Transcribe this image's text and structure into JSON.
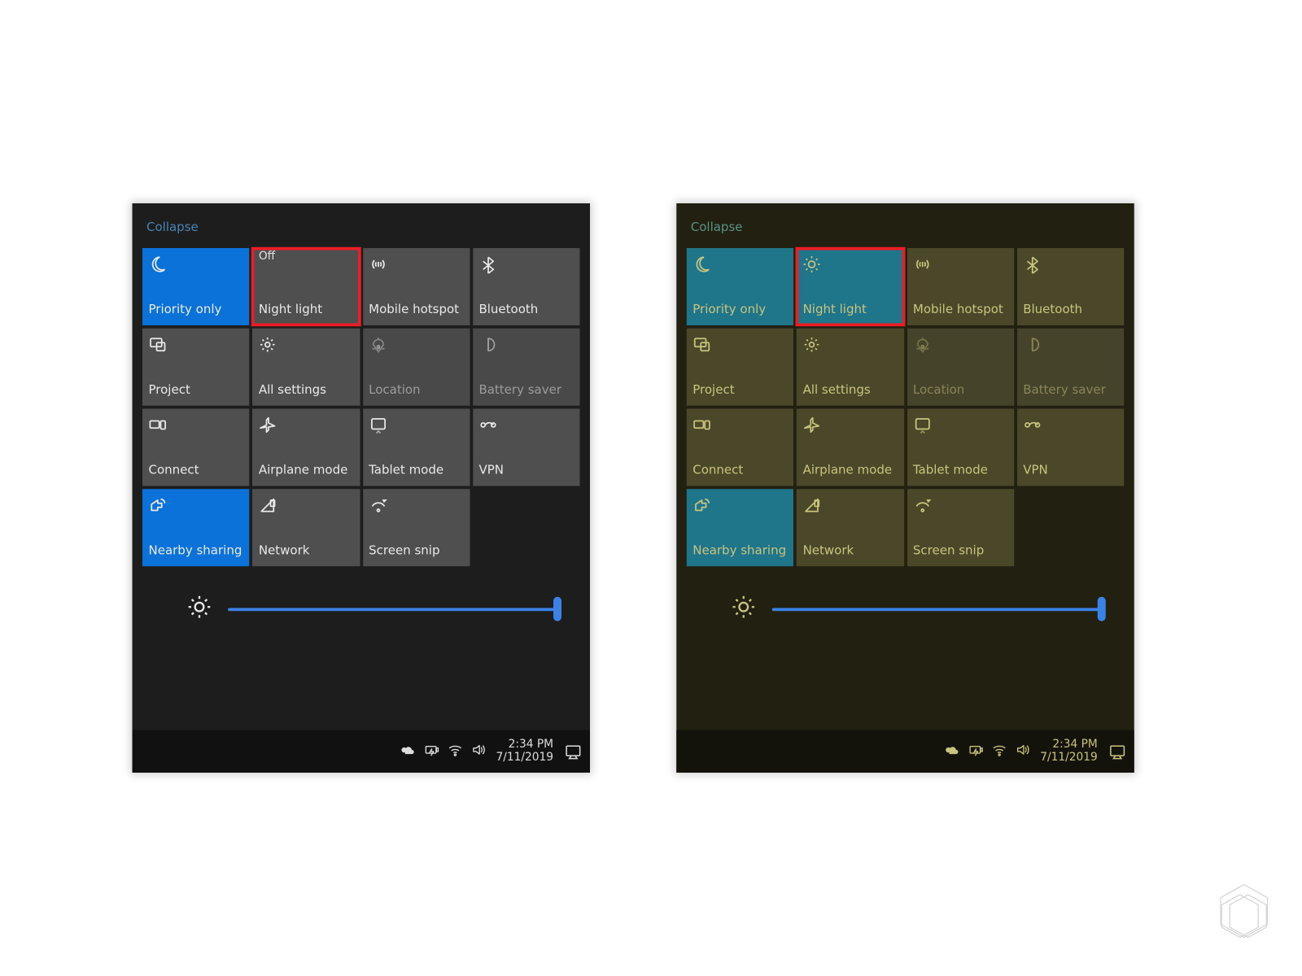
{
  "collapse_label": "Collapse",
  "night_light_status_off": "Off",
  "tiles": {
    "priority_only": "Priority only",
    "night_light": "Night light",
    "mobile_hotspot": "Mobile hotspot",
    "bluetooth": "Bluetooth",
    "project": "Project",
    "all_settings": "All settings",
    "location": "Location",
    "battery_saver": "Battery saver",
    "connect": "Connect",
    "airplane_mode": "Airplane mode",
    "tablet_mode": "Tablet mode",
    "vpn": "VPN",
    "nearby_sharing": "Nearby sharing",
    "network": "Network",
    "screen_snip": "Screen snip"
  },
  "brightness_value": 100,
  "taskbar": {
    "time": "2:34 PM",
    "date": "7/11/2019"
  },
  "panel_left": {
    "theme": "dark",
    "night_light_active": false,
    "active_tiles": [
      "priority_only",
      "nearby_sharing"
    ],
    "dim_tiles": [
      "location",
      "battery_saver"
    ]
  },
  "panel_right": {
    "theme": "warm",
    "night_light_active": true,
    "active_tiles": [
      "priority_only",
      "night_light",
      "nearby_sharing"
    ],
    "dim_tiles": [
      "location",
      "battery_saver"
    ]
  }
}
